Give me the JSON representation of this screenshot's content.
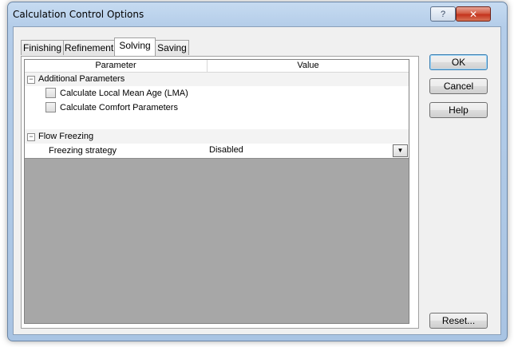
{
  "window": {
    "title": "Calculation Control Options",
    "help_label": "?",
    "close_label": "✕"
  },
  "tabs": [
    {
      "label": "Finishing"
    },
    {
      "label": "Refinement"
    },
    {
      "label": "Solving",
      "selected": true
    },
    {
      "label": "Saving"
    }
  ],
  "grid": {
    "headers": {
      "parameter": "Parameter",
      "value": "Value"
    },
    "sections": [
      {
        "label": "Additional Parameters",
        "expander": "−",
        "items": [
          {
            "label": "Calculate Local Mean Age (LMA)",
            "checked": false
          },
          {
            "label": "Calculate Comfort Parameters",
            "checked": false
          }
        ]
      },
      {
        "label": "Flow Freezing",
        "expander": "−",
        "property": {
          "label": "Freezing strategy",
          "value": "Disabled"
        }
      }
    ],
    "dropdown_icon": "▼"
  },
  "buttons": {
    "ok": "OK",
    "cancel": "Cancel",
    "help": "Help",
    "reset": "Reset..."
  }
}
